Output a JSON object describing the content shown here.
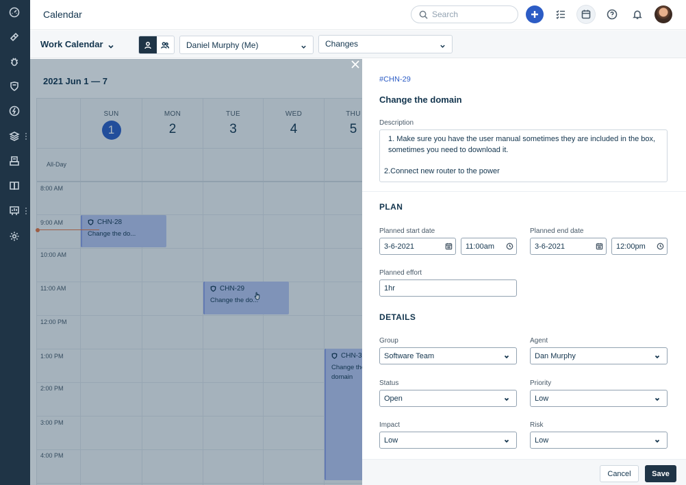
{
  "topbar": {
    "title": "Calendar",
    "search_placeholder": "Search"
  },
  "subbar": {
    "calendar_name": "Work Calendar",
    "person_select": "Daniel Murphy (Me)",
    "type_select": "Changes"
  },
  "calendar": {
    "range_title": "2021 Jun 1 — 7",
    "days": [
      {
        "name": "SUN",
        "num": "1"
      },
      {
        "name": "MON",
        "num": "2"
      },
      {
        "name": "TUE",
        "num": "3"
      },
      {
        "name": "WED",
        "num": "4"
      },
      {
        "name": "THU",
        "num": "5"
      }
    ],
    "allday_label": "All-Day",
    "times": [
      "8:00 AM",
      "9:00 AM",
      "10:00 AM",
      "11:00 AM",
      "12:00 PM",
      "1:00 PM",
      "2:00 PM",
      "3:00 PM",
      "4:00 PM"
    ],
    "events": [
      {
        "id": "CHN-28",
        "title": "Change the do..."
      },
      {
        "id": "CHN-29",
        "title": "Change the do..."
      },
      {
        "id": "CHN-3",
        "title": "Change the domain"
      }
    ]
  },
  "panel": {
    "id": "#CHN-29",
    "title": "Change the domain",
    "description_label": "Description",
    "description_line1": "1. Make sure you have the user manual sometimes they are included in the box, sometimes you need to download it.",
    "description_line2": "2.Connect new router to the power",
    "plan_heading": "PLAN",
    "start_label": "Planned start date",
    "start_date": "3-6-2021",
    "start_time": "11:00am",
    "end_label": "Planned end date",
    "end_date": "3-6-2021",
    "end_time": "12:00pm",
    "effort_label": "Planned effort",
    "effort": "1hr",
    "details_heading": "DETAILS",
    "group_label": "Group",
    "group": "Software Team",
    "agent_label": "Agent",
    "agent": "Dan Murphy",
    "status_label": "Status",
    "status": "Open",
    "priority_label": "Priority",
    "priority": "Low",
    "impact_label": "Impact",
    "impact": "Low",
    "risk_label": "Risk",
    "risk": "Low"
  },
  "footer": {
    "cancel": "Cancel",
    "save": "Save"
  },
  "colors": {
    "nav": "#1f3446",
    "accent": "#2c5cc5",
    "event": "#bac7f2"
  }
}
